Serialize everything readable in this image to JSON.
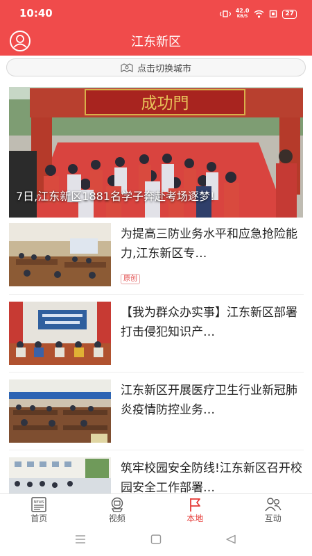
{
  "status_bar": {
    "time": "10:40",
    "net_speed_value": "42.0",
    "net_speed_unit": "KB/S",
    "battery": "27"
  },
  "header": {
    "title": "江东新区",
    "city_switch_label": "点击切换城市"
  },
  "hero": {
    "caption": "7日,江东新区1881名学子奔赴考场逐梦!",
    "sign_text": "成功門"
  },
  "news": [
    {
      "title": "为提高三防业务水平和应急抢险能力,江东新区专…",
      "badge": "原创"
    },
    {
      "title": "【我为群众办实事】江东新区部署打击侵犯知识产…"
    },
    {
      "title": "江东新区开展医疗卫生行业新冠肺炎疫情防控业务…"
    },
    {
      "title": "筑牢校园安全防线!江东新区召开校园安全工作部署…"
    }
  ],
  "tabs": [
    {
      "label": "首页",
      "icon": "newspaper-icon"
    },
    {
      "label": "视频",
      "icon": "video-icon"
    },
    {
      "label": "本地",
      "icon": "flag-icon"
    },
    {
      "label": "互动",
      "icon": "people-icon"
    }
  ],
  "active_tab": "本地",
  "colors": {
    "brand_red": "#f04b4b",
    "active_tab": "#e53935",
    "badge_red": "#e34a4a"
  }
}
